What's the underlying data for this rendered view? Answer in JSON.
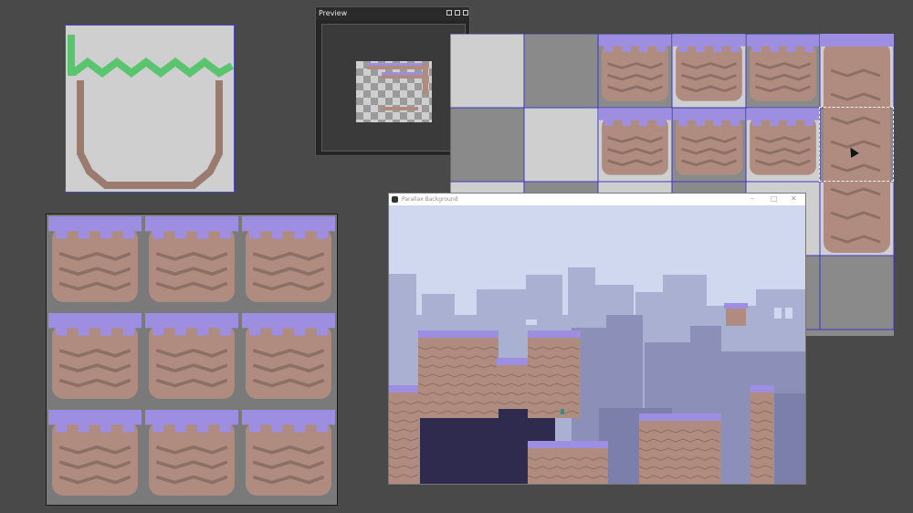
{
  "preview_panel": {
    "title": "Preview",
    "buttons": [
      "maximize-icon",
      "pin-icon",
      "close-icon"
    ]
  },
  "game_window": {
    "title": "Parallax Background",
    "controls": {
      "minimize": "–",
      "maximize": "□",
      "close": "✕"
    },
    "icon": "app-icon"
  },
  "colors": {
    "canvas_bg": "#494949",
    "tile_grass": "#9d8ee2",
    "tile_dirt": "#b08c80",
    "tile_dirt_dark": "#8d6f66",
    "grid_line": "#3b38c9",
    "outline_green": "#5bc46f",
    "sky": "#cfd8ee",
    "building_far": "#9ba3c7",
    "building_mid": "#8387b0",
    "dark_brick": "#2e2b4e"
  }
}
